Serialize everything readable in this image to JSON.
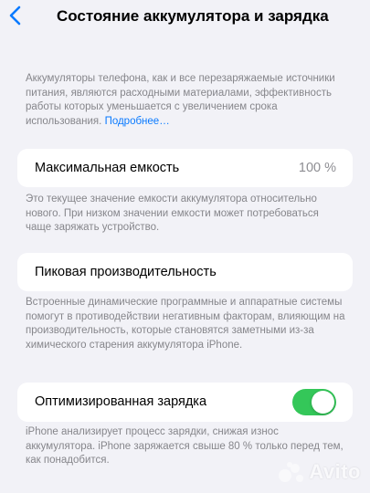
{
  "header": {
    "title": "Состояние аккумулятора и зарядка"
  },
  "intro": {
    "text": "Аккумуляторы телефона, как и все перезаряжаемые источники питания, являются расходными материалами, эффективность работы которых уменьшается с увеличением срока использования.",
    "link": "Подробнее…"
  },
  "max_capacity": {
    "label": "Максимальная емкость",
    "value": "100 %",
    "note": "Это текущее значение емкости аккумулятора относительно нового. При низком значении емкости может потребоваться чаще заряжать устройство."
  },
  "peak_performance": {
    "label": "Пиковая производительность",
    "note": "Встроенные динамические программные и аппаратные системы помогут в противодействии негативным факторам, влияющим на производительность, которые становятся заметными из-за химического старения аккумулятора iPhone."
  },
  "optimized_charging": {
    "label": "Оптимизированная зарядка",
    "enabled": true,
    "note": "iPhone анализирует процесс зарядки, снижая износ аккумулятора. iPhone заряжается свыше 80 % только перед тем, как понадобится."
  },
  "watermark": {
    "brand": "Avito"
  },
  "colors": {
    "accent": "#0a7aff",
    "toggle_on": "#34c759",
    "background": "#f2f2f7"
  },
  "icons": {
    "back": "chevron-left-icon",
    "watermark": "avito-logo-icon"
  }
}
